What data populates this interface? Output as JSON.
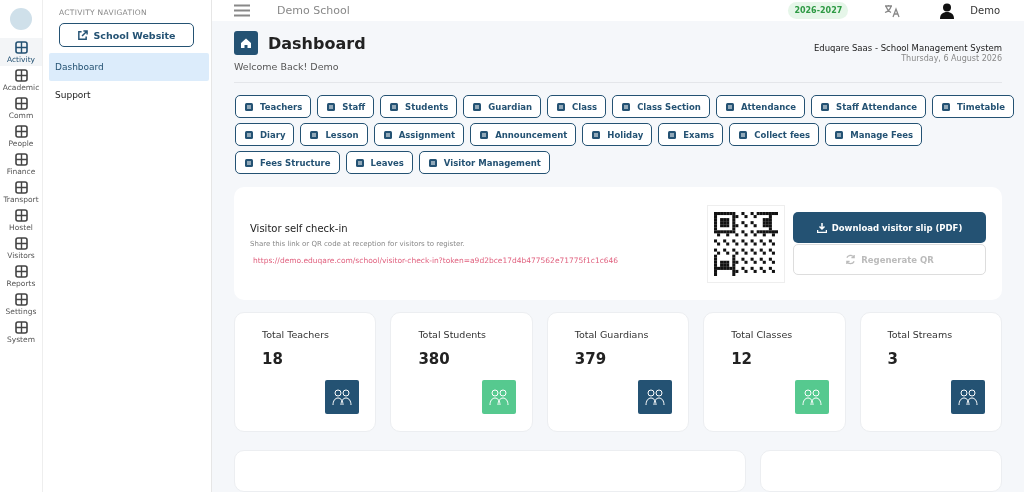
{
  "rail": [
    {
      "label": "Activity",
      "selected": true
    },
    {
      "label": "Academic",
      "selected": false
    },
    {
      "label": "Comm",
      "selected": false
    },
    {
      "label": "People",
      "selected": false
    },
    {
      "label": "Finance",
      "selected": false
    },
    {
      "label": "Transport",
      "selected": false
    },
    {
      "label": "Hostel",
      "selected": false
    },
    {
      "label": "Visitors",
      "selected": false
    },
    {
      "label": "Reports",
      "selected": false
    },
    {
      "label": "Settings",
      "selected": false
    },
    {
      "label": "System",
      "selected": false
    }
  ],
  "nav": {
    "heading": "ACTIVITY NAVIGATION",
    "website_button": "School Website",
    "items": [
      {
        "label": "Dashboard",
        "selected": true
      },
      {
        "label": "Support",
        "selected": false
      }
    ]
  },
  "topbar": {
    "school": "Demo School",
    "session": "2026-2027",
    "user": "Demo"
  },
  "header": {
    "title": "Dashboard",
    "welcome": "Welcome Back! Demo",
    "system": "Eduqare Saas - School Management System",
    "date": "Thursday, 6 August 2026"
  },
  "shortcuts": [
    "Teachers",
    "Staff",
    "Students",
    "Guardian",
    "Class",
    "Class Section",
    "Attendance",
    "Staff Attendance",
    "Timetable",
    "Diary",
    "Lesson",
    "Assignment",
    "Announcement",
    "Holiday",
    "Exams",
    "Collect fees",
    "Manage Fees",
    "Fees Structure",
    "Leaves",
    "Visitor Management"
  ],
  "visitor": {
    "title": "Visitor self check-in",
    "hint": "Share this link or QR code at reception for visitors to register.",
    "link": "https://demo.eduqare.com/school/visitor-check-in?token=a9d2bce17d4b477562e71775f1c1c646",
    "download": "Download visitor slip (PDF)",
    "regenerate": "Regenerate QR",
    "regenerate_disabled": true
  },
  "stats": [
    {
      "label": "Total Teachers",
      "value": "18",
      "color": "#245273"
    },
    {
      "label": "Total Students",
      "value": "380",
      "color": "#56c98f"
    },
    {
      "label": "Total Guardians",
      "value": "379",
      "color": "#245273"
    },
    {
      "label": "Total Classes",
      "value": "12",
      "color": "#56c98f"
    },
    {
      "label": "Total Streams",
      "value": "3",
      "color": "#245273"
    }
  ]
}
